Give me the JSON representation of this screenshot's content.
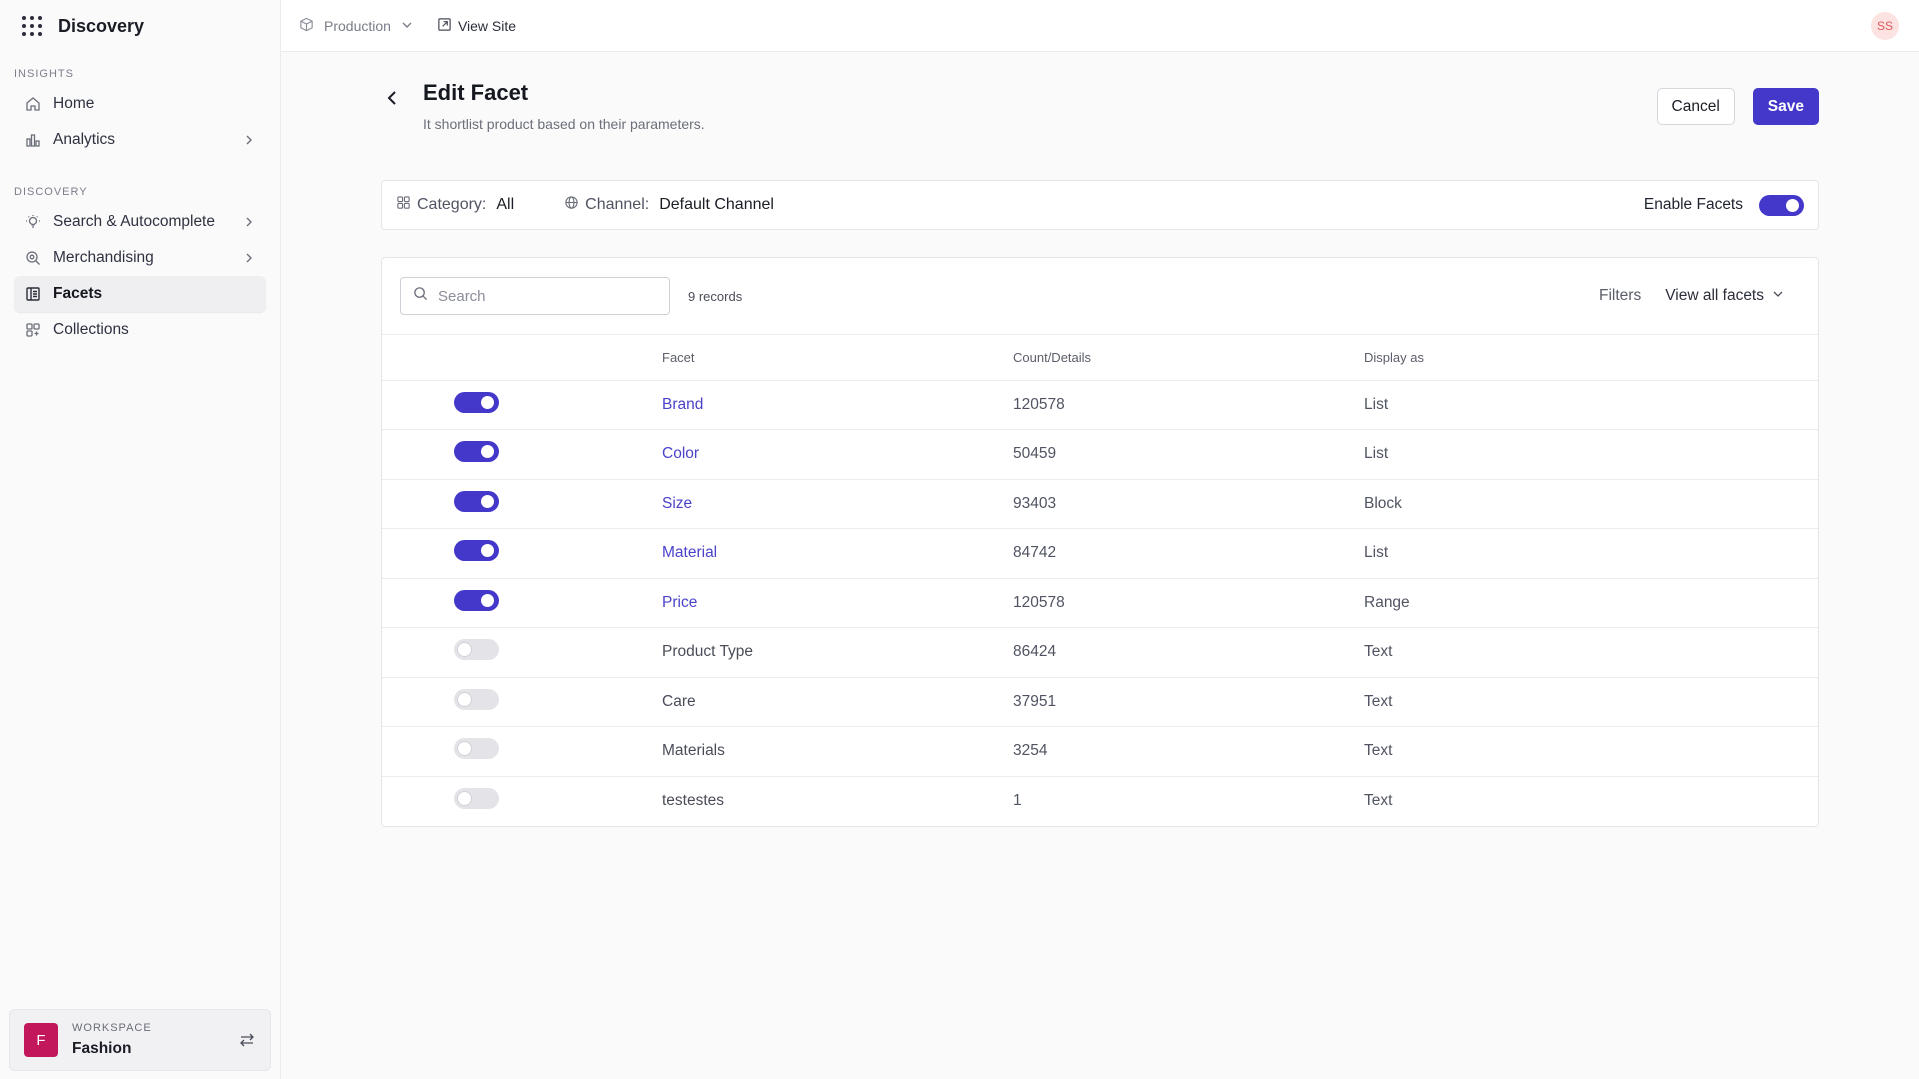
{
  "app": {
    "name": "Discovery"
  },
  "sidebar": {
    "sections": [
      {
        "label": "INSIGHTS"
      },
      {
        "label": "DISCOVERY"
      }
    ],
    "items": [
      {
        "label": "Home"
      },
      {
        "label": "Analytics"
      },
      {
        "label": "Search & Autocomplete"
      },
      {
        "label": "Merchandising"
      },
      {
        "label": "Facets"
      },
      {
        "label": "Collections"
      }
    ],
    "workspace": {
      "label": "WORKSPACE",
      "name": "Fashion",
      "initial": "F"
    }
  },
  "topbar": {
    "environment": "Production",
    "view_site": "View Site",
    "user_initials": "SS"
  },
  "page": {
    "title": "Edit Facet",
    "subtitle": "It shortlist product based on their parameters.",
    "cancel_label": "Cancel",
    "save_label": "Save"
  },
  "filter_bar": {
    "category_label": "Category:",
    "category_value": "All",
    "channel_label": "Channel:",
    "channel_value": "Default Channel",
    "enable_label": "Enable Facets",
    "enabled": true
  },
  "table": {
    "search_placeholder": "Search",
    "records": "9 records",
    "filters_label": "Filters",
    "view_all_label": "View all facets",
    "columns": [
      "Facet",
      "Count/Details",
      "Display as"
    ],
    "rows": [
      {
        "enabled": true,
        "facet": "Brand",
        "count": "120578",
        "display": "List"
      },
      {
        "enabled": true,
        "facet": "Color",
        "count": "50459",
        "display": "List"
      },
      {
        "enabled": true,
        "facet": "Size",
        "count": "93403",
        "display": "Block"
      },
      {
        "enabled": true,
        "facet": "Material",
        "count": "84742",
        "display": "List"
      },
      {
        "enabled": true,
        "facet": "Price",
        "count": "120578",
        "display": "Range"
      },
      {
        "enabled": false,
        "facet": "Product Type",
        "count": "86424",
        "display": "Text"
      },
      {
        "enabled": false,
        "facet": "Care",
        "count": "37951",
        "display": "Text"
      },
      {
        "enabled": false,
        "facet": "Materials",
        "count": "3254",
        "display": "Text"
      },
      {
        "enabled": false,
        "facet": "testestes",
        "count": "1",
        "display": "Text"
      }
    ]
  },
  "colors": {
    "accent": "#4338ca",
    "workspace": "#c2185b"
  }
}
